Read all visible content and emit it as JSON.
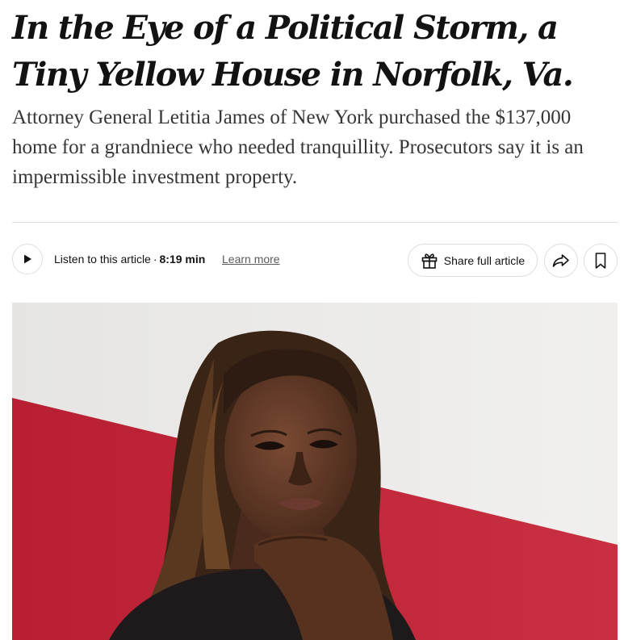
{
  "article": {
    "headline": "In the Eye of a Political Storm, a Tiny Yellow House in Norfolk, Va.",
    "summary": "Attorney General Letitia James of New York purchased the $137,000 home for a grandniece who needed tranquillity. Prosecutors say it is an impermissible investment property."
  },
  "toolbar": {
    "listen_label": "Listen to this article",
    "separator": "·",
    "duration": "8:19 min",
    "learn_more": "Learn more",
    "share_label": "Share full article",
    "icons": {
      "play": "play-icon",
      "gift": "gift-icon",
      "share": "share-arrow-icon",
      "save": "bookmark-icon"
    }
  },
  "colors": {
    "text": "#121212",
    "summary_text": "#363636",
    "border": "#dfdfdf",
    "backdrop_red": "#c8283a",
    "backdrop_white": "#eceae8"
  }
}
